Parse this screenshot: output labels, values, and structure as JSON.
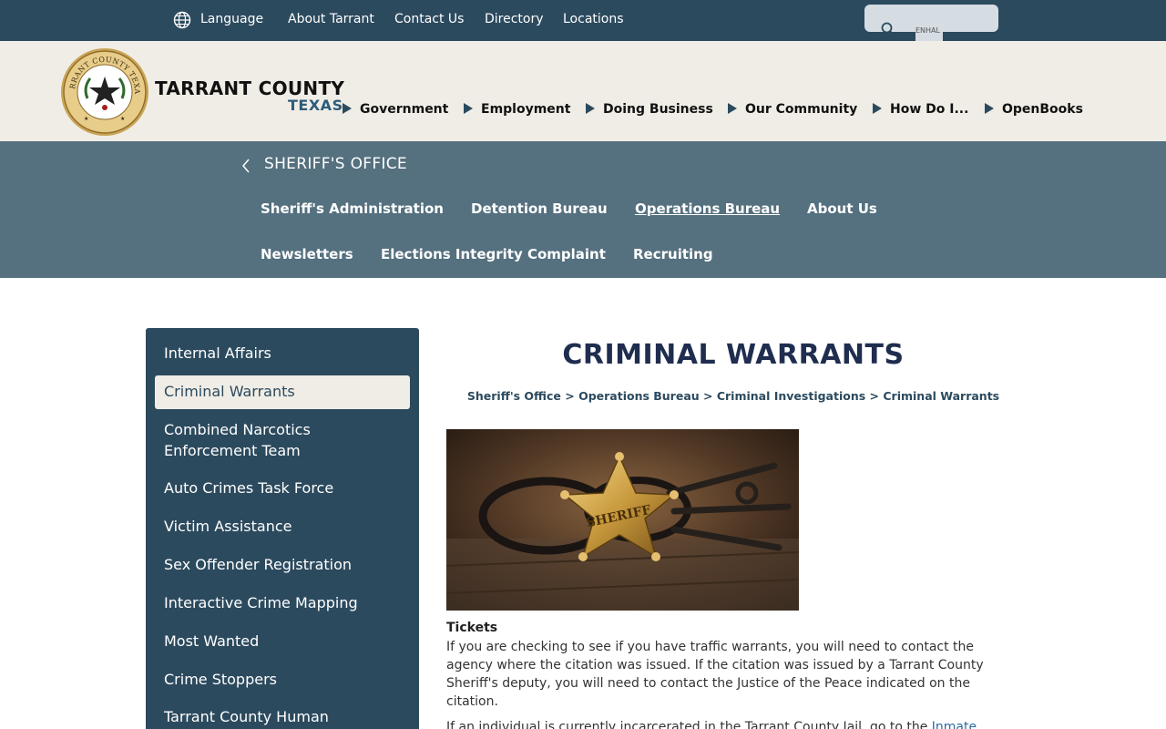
{
  "topbar": {
    "language": "Language",
    "links": [
      "About Tarrant",
      "Contact Us",
      "Directory",
      "Locations"
    ],
    "search_enhance_label": "ENHAL"
  },
  "brand": {
    "name": "TARRANT COUNTY",
    "state": "TEXAS",
    "seal_text": "TARRANT COUNTY TEXAS"
  },
  "main_nav": [
    "Government",
    "Employment",
    "Doing Business",
    "Our Community",
    "How Do I...",
    "OpenBooks"
  ],
  "section": {
    "title": "SHERIFF'S OFFICE",
    "nav_row1": [
      "Sheriff's Administration",
      "Detention Bureau",
      "Operations Bureau",
      "About Us"
    ],
    "nav_row2": [
      "Newsletters",
      "Elections Integrity Complaint",
      "Recruiting"
    ],
    "active": "Operations Bureau"
  },
  "sidebar": {
    "items": [
      "Internal Affairs",
      "Criminal Warrants",
      "Combined Narcotics",
      "Enforcement Team",
      "Auto Crimes Task Force",
      "Victim Assistance",
      "Sex Offender Registration",
      "Interactive Crime Mapping",
      "Most Wanted",
      "Crime Stoppers",
      "Tarrant County Human"
    ],
    "active": "Criminal Warrants"
  },
  "content": {
    "title": "CRIMINAL WARRANTS",
    "breadcrumb": "Sheriff's Office > Operations Bureau > Criminal Investigations > Criminal Warrants",
    "badge_text": "SHERIFF",
    "tickets_heading": "Tickets",
    "tickets_lines": [
      "If you are checking to see if you have traffic warrants, you will need to contact the",
      "agency where the citation was issued. If the citation was issued by a Tarrant County",
      "Sheriff's deputy, you will need to contact the Justice of the Peace indicated on the",
      "citation."
    ],
    "jail_text": "If an individual is currently incarcerated in the Tarrant County Jail, go to the",
    "jail_link": "Inmate"
  },
  "colors": {
    "topbar": "#2c4a5e",
    "header": "#f0ede6",
    "section_bar": "#55707f",
    "sidebar": "#2c4a5e",
    "title": "#1f2d4f"
  }
}
